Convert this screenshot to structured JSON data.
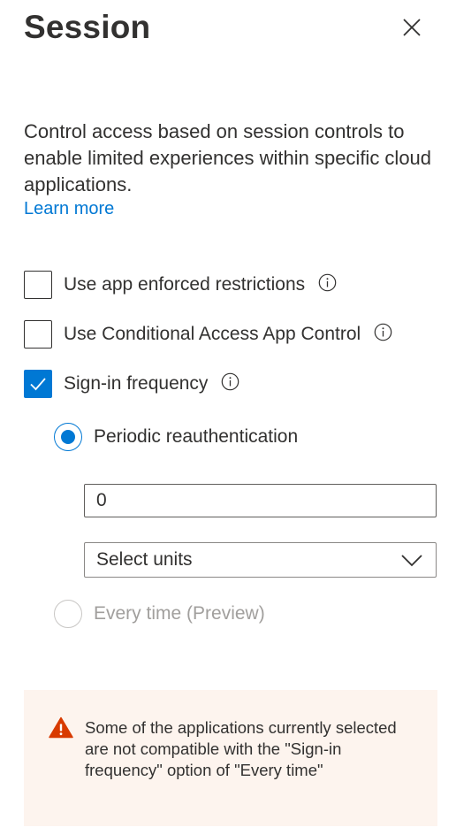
{
  "panel": {
    "title": "Session",
    "close_label": "close"
  },
  "description": "Control access based on session controls to enable limited experiences within specific cloud applications.",
  "learn_more": "Learn more",
  "options": [
    {
      "label": "Use app enforced restrictions",
      "checked": false,
      "info": true
    },
    {
      "label": "Use Conditional Access App Control",
      "checked": false,
      "info": true
    },
    {
      "label": "Sign-in frequency",
      "checked": true,
      "info": true
    }
  ],
  "sign_in_frequency": {
    "periodic": {
      "label": "Periodic reauthentication",
      "selected": true
    },
    "value": "0",
    "units": {
      "value": "Select units"
    },
    "every_time": {
      "label": "Every time (Preview)",
      "selected": false,
      "disabled": true
    }
  },
  "warning": {
    "icon": "warning-icon",
    "text": "Some of the applications currently selected are not compatible with the \"Sign-in frequency\" option of \"Every time\""
  },
  "colors": {
    "accent": "#0078d4",
    "text": "#323130",
    "warning_bg": "#fdf4ee",
    "warning_icon": "#d83b01",
    "disabled": "#a19f9d"
  }
}
